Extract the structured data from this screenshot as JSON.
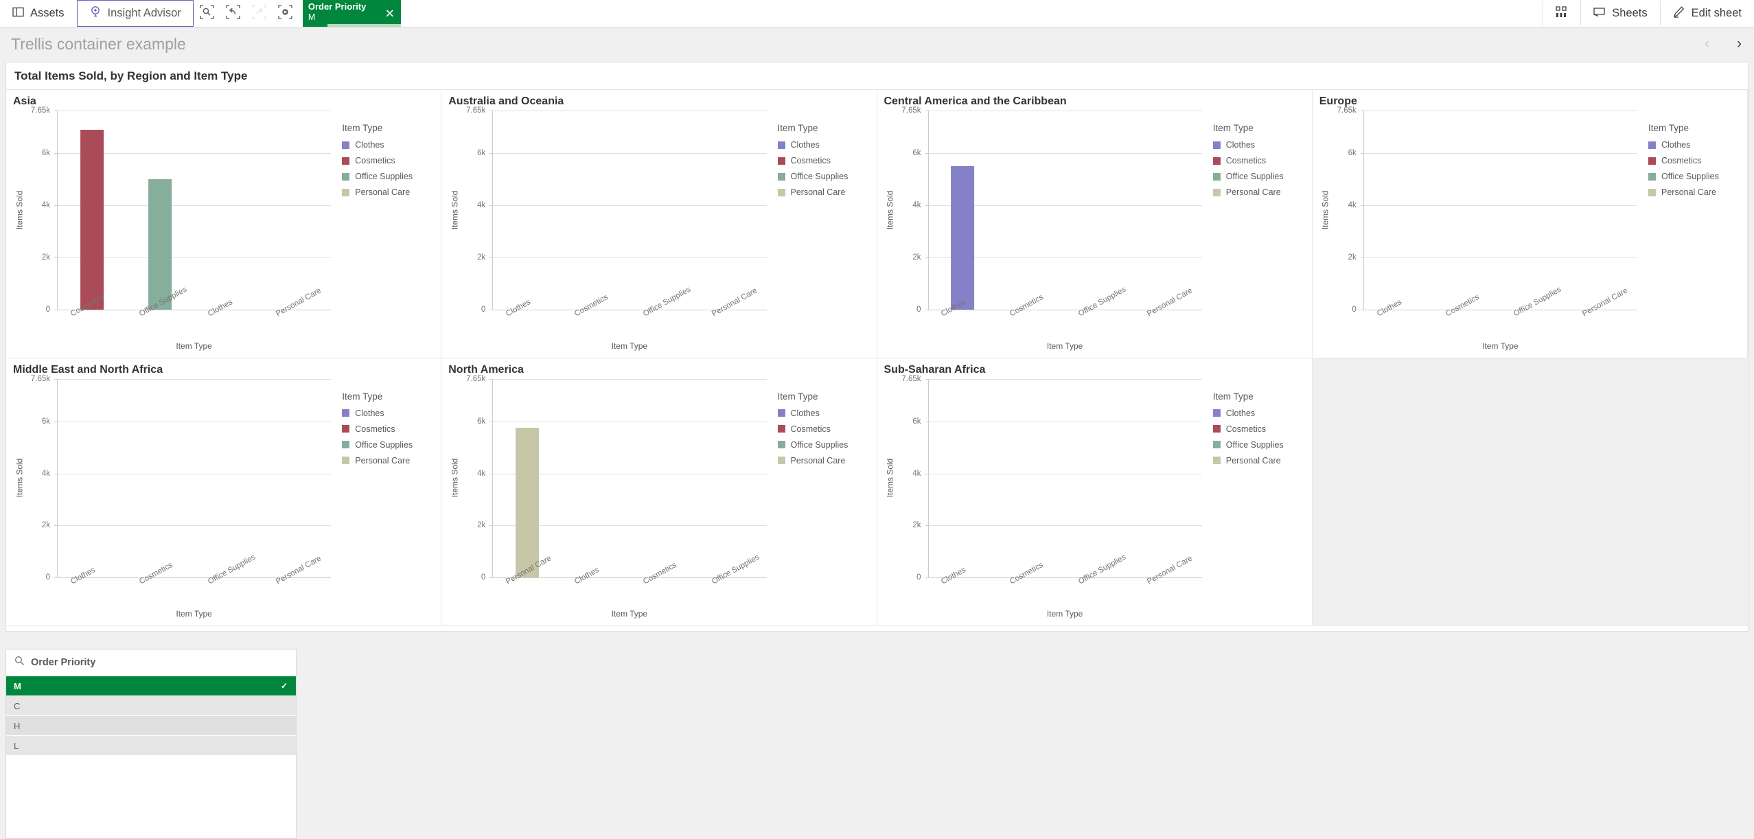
{
  "toolbar": {
    "assets_label": "Assets",
    "insight_advisor_label": "Insight Advisor",
    "assets_icon": "panel-icon",
    "insight_advisor_icon": "lightbulb-icon",
    "smart_search_icon": "search-selection-icon",
    "step_back_icon": "undo-arrow-icon",
    "step_forward_icon": "redo-arrow-icon",
    "clear_selections_icon": "clear-selection-icon",
    "selection": {
      "field": "Order Priority",
      "value": "M",
      "close_icon": "close-icon",
      "accent_color": "#00873d"
    },
    "app_overview_icon": "grid-bars-icon",
    "sheets_label": "Sheets",
    "sheets_icon": "sheet-icon",
    "edit_sheet_label": "Edit sheet",
    "edit_sheet_icon": "pencil-icon"
  },
  "sheet": {
    "title": "Trellis container example",
    "prev_icon": "chevron-left-icon",
    "next_icon": "chevron-right-icon"
  },
  "container": {
    "title": "Total Items Sold, by Region and Item Type"
  },
  "legend": {
    "title": "Item Type",
    "items": [
      {
        "label": "Clothes",
        "color": "#8581c9"
      },
      {
        "label": "Cosmetics",
        "color": "#ac4b58"
      },
      {
        "label": "Office Supplies",
        "color": "#86ae9b"
      },
      {
        "label": "Personal Care",
        "color": "#c7c6a7"
      }
    ]
  },
  "axis": {
    "ylabel": "Items Sold",
    "xlabel": "Item Type",
    "yticks": [
      "7.65k",
      "6k",
      "4k",
      "2k",
      "0"
    ]
  },
  "filter_pane": {
    "search_icon": "search-icon",
    "field_label": "Order Priority",
    "check_icon": "check-icon",
    "values": [
      {
        "label": "M",
        "state": "selected"
      },
      {
        "label": "C",
        "state": "alternative"
      },
      {
        "label": "H",
        "state": "alternative"
      },
      {
        "label": "L",
        "state": "alternative"
      }
    ]
  },
  "chart_data": [
    {
      "type": "bar",
      "title": "Asia",
      "xlabel": "Item Type",
      "ylabel": "Items Sold",
      "ylim": [
        0,
        7650
      ],
      "ytick_values": [
        7650,
        6000,
        4000,
        2000,
        0
      ],
      "grid": true,
      "legend_position": "right",
      "categories": [
        "Cosmetics",
        "Office Supplies",
        "Clothes",
        "Personal Care"
      ],
      "values": [
        6900,
        5000,
        0,
        0
      ],
      "colors": [
        "#ac4b58",
        "#86ae9b",
        "#8581c9",
        "#c7c6a7"
      ]
    },
    {
      "type": "bar",
      "title": "Australia and Oceania",
      "xlabel": "Item Type",
      "ylabel": "Items Sold",
      "ylim": [
        0,
        7650
      ],
      "ytick_values": [
        7650,
        6000,
        4000,
        2000,
        0
      ],
      "grid": true,
      "legend_position": "right",
      "categories": [
        "Clothes",
        "Cosmetics",
        "Office Supplies",
        "Personal Care"
      ],
      "values": [
        0,
        0,
        0,
        0
      ],
      "colors": [
        "#8581c9",
        "#ac4b58",
        "#86ae9b",
        "#c7c6a7"
      ]
    },
    {
      "type": "bar",
      "title": "Central America and the Caribbean",
      "xlabel": "Item Type",
      "ylabel": "Items Sold",
      "ylim": [
        0,
        7650
      ],
      "ytick_values": [
        7650,
        6000,
        4000,
        2000,
        0
      ],
      "grid": true,
      "legend_position": "right",
      "categories": [
        "Clothes",
        "Cosmetics",
        "Office Supplies",
        "Personal Care"
      ],
      "values": [
        5500,
        0,
        0,
        0
      ],
      "colors": [
        "#8581c9",
        "#ac4b58",
        "#86ae9b",
        "#c7c6a7"
      ]
    },
    {
      "type": "bar",
      "title": "Europe",
      "xlabel": "Item Type",
      "ylabel": "Items Sold",
      "ylim": [
        0,
        7650
      ],
      "ytick_values": [
        7650,
        6000,
        4000,
        2000,
        0
      ],
      "grid": true,
      "legend_position": "right",
      "categories": [
        "Clothes",
        "Cosmetics",
        "Office Supplies",
        "Personal Care"
      ],
      "values": [
        0,
        0,
        0,
        0
      ],
      "colors": [
        "#8581c9",
        "#ac4b58",
        "#86ae9b",
        "#c7c6a7"
      ]
    },
    {
      "type": "bar",
      "title": "Middle East and North Africa",
      "xlabel": "Item Type",
      "ylabel": "Items Sold",
      "ylim": [
        0,
        7650
      ],
      "ytick_values": [
        7650,
        6000,
        4000,
        2000,
        0
      ],
      "grid": true,
      "legend_position": "right",
      "categories": [
        "Clothes",
        "Cosmetics",
        "Office Supplies",
        "Personal Care"
      ],
      "values": [
        0,
        0,
        0,
        0
      ],
      "colors": [
        "#8581c9",
        "#ac4b58",
        "#86ae9b",
        "#c7c6a7"
      ]
    },
    {
      "type": "bar",
      "title": "North America",
      "xlabel": "Item Type",
      "ylabel": "Items Sold",
      "ylim": [
        0,
        7650
      ],
      "ytick_values": [
        7650,
        6000,
        4000,
        2000,
        0
      ],
      "grid": true,
      "legend_position": "right",
      "categories": [
        "Personal Care",
        "Clothes",
        "Cosmetics",
        "Office Supplies"
      ],
      "values": [
        5750,
        0,
        0,
        0
      ],
      "colors": [
        "#c7c6a7",
        "#8581c9",
        "#ac4b58",
        "#86ae9b"
      ]
    },
    {
      "type": "bar",
      "title": "Sub-Saharan Africa",
      "xlabel": "Item Type",
      "ylabel": "Items Sold",
      "ylim": [
        0,
        7650
      ],
      "ytick_values": [
        7650,
        6000,
        4000,
        2000,
        0
      ],
      "grid": true,
      "legend_position": "right",
      "categories": [
        "Clothes",
        "Cosmetics",
        "Office Supplies",
        "Personal Care"
      ],
      "values": [
        0,
        0,
        0,
        0
      ],
      "colors": [
        "#8581c9",
        "#ac4b58",
        "#86ae9b",
        "#c7c6a7"
      ]
    }
  ]
}
